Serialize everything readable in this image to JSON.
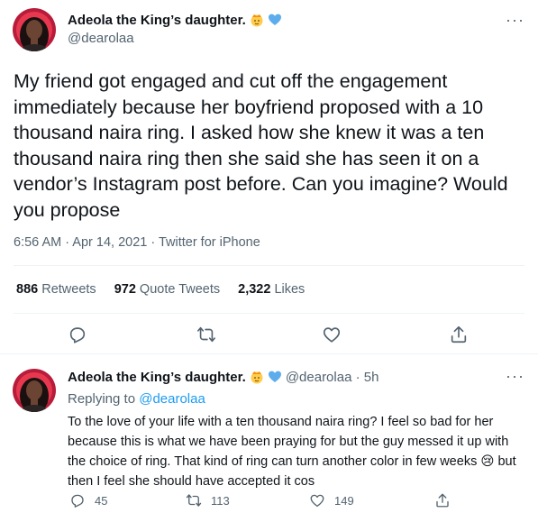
{
  "tweet": {
    "author_name": "Adeola the King’s daughter.",
    "emojis": [
      "princess-emoji",
      "blue-heart-emoji"
    ],
    "handle": "@dearolaa",
    "text": "My friend got engaged and cut off the engagement immediately because her boyfriend proposed with a 10 thousand naira ring. I asked how she knew it was a ten thousand naira ring then she said she has seen it on a vendor’s Instagram post before. Can you imagine? Would you propose",
    "meta": "6:56 AM · Apr 14, 2021 · Twitter for iPhone",
    "stats": {
      "retweets_count": "886",
      "retweets_label": "Retweets",
      "quotes_count": "972",
      "quotes_label": "Quote Tweets",
      "likes_count": "2,322",
      "likes_label": "Likes"
    },
    "more_label": "···",
    "actions": [
      "reply-icon",
      "retweet-icon",
      "like-icon",
      "share-icon"
    ]
  },
  "reply": {
    "author_name": "Adeola the King’s daughter.",
    "handle_time": "@dearolaa · 5h",
    "replying_prefix": "Replying to",
    "replying_to": "@dearolaa",
    "text": "To the love of your life with a ten thousand naira ring? I feel so bad for her because this is what we have been praying for but the guy messed it up with the choice of ring. That kind of ring can turn another color in few weeks 😢 but then I feel she should have accepted it cos",
    "more_label": "···",
    "counts": {
      "replies": "45",
      "retweets": "113",
      "likes": "149"
    }
  },
  "colors": {
    "text": "#0f1419",
    "secondary": "#536471",
    "link": "#1d9bf0",
    "divider": "#eff3f4"
  }
}
